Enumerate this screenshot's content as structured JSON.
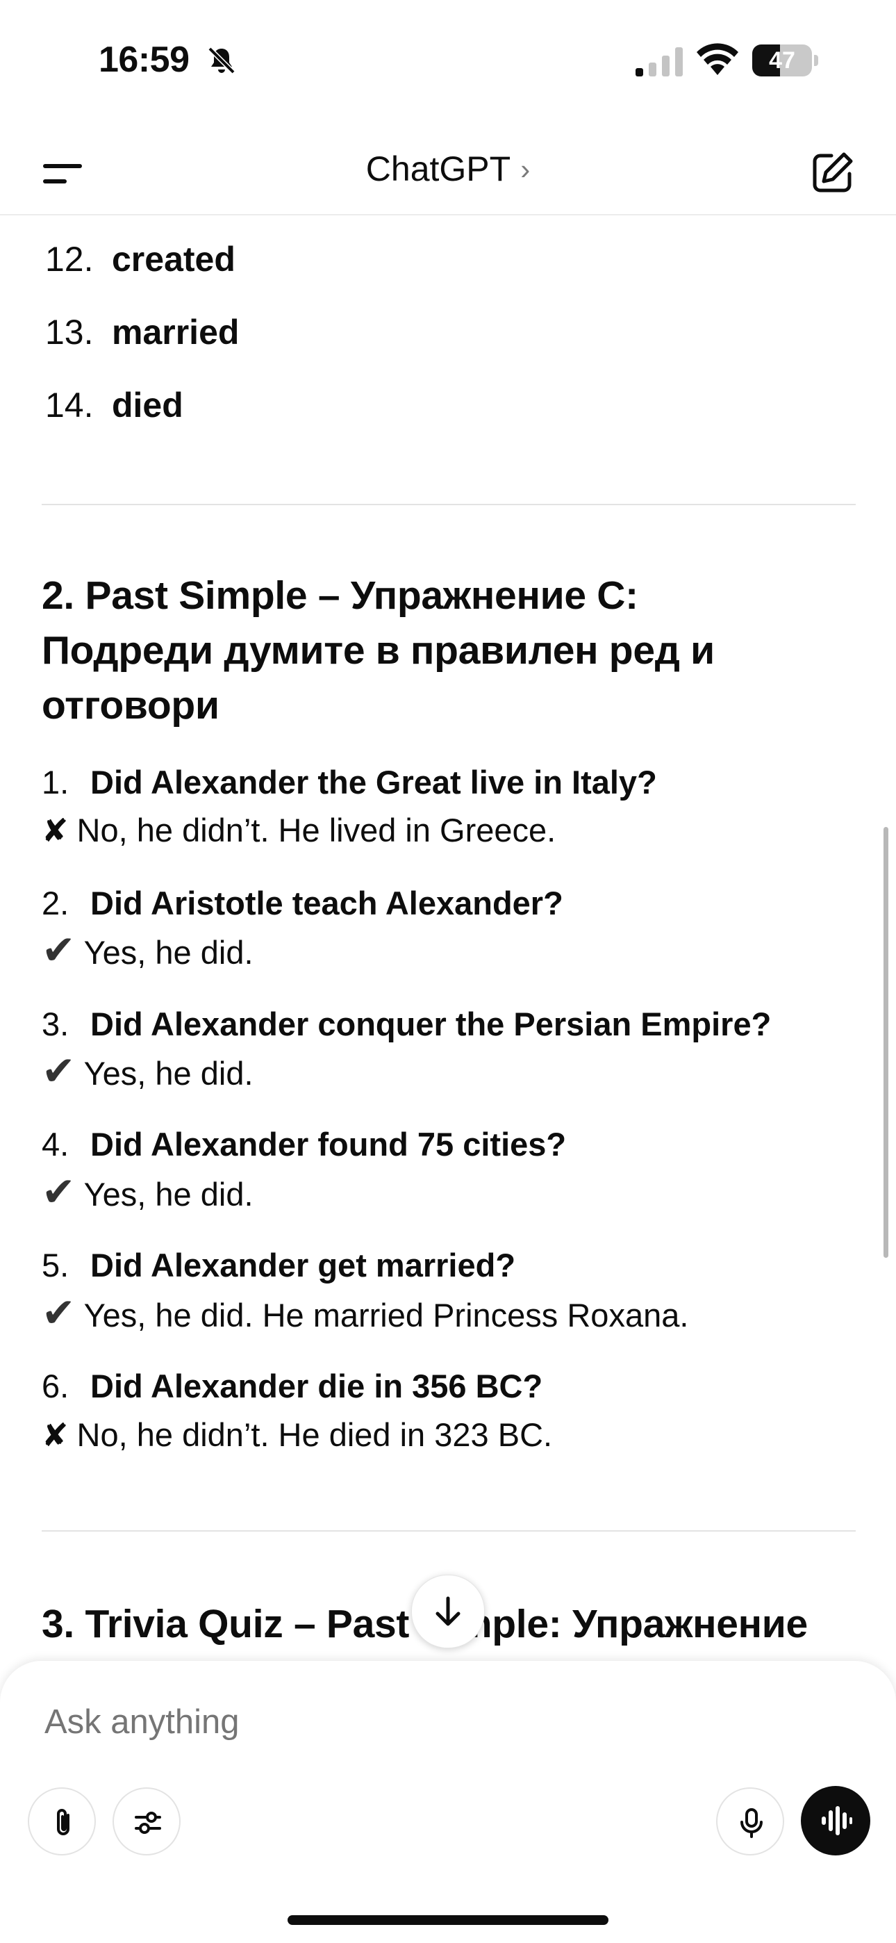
{
  "status_bar": {
    "time": "16:59",
    "battery_level": 47,
    "battery_label": "47"
  },
  "header": {
    "title": "ChatGPT",
    "chevron": "›"
  },
  "prev_list": [
    {
      "num": "12.",
      "word": "created"
    },
    {
      "num": "13.",
      "word": "married"
    },
    {
      "num": "14.",
      "word": "died"
    }
  ],
  "section2": {
    "heading_line1": "2. Past Simple – Упражнение C:",
    "heading_line2": "Подреди думите в правилен ред и",
    "heading_line3": "отговори",
    "items": [
      {
        "num": "1.",
        "question": "Did Alexander the Great live in Italy?",
        "mark": "✘",
        "answer": "No, he didn’t. He lived in Greece."
      },
      {
        "num": "2.",
        "question": "Did Aristotle teach Alexander?",
        "mark": "✔",
        "answer": "Yes, he did."
      },
      {
        "num": "3.",
        "question": "Did Alexander conquer the Persian Empire?",
        "mark": "✔",
        "answer": "Yes, he did."
      },
      {
        "num": "4.",
        "question": "Did Alexander found 75 cities?",
        "mark": "✔",
        "answer": "Yes, he did."
      },
      {
        "num": "5.",
        "question": "Did Alexander get married?",
        "mark": "✔",
        "answer": "Yes, he did. He married Princess Roxana."
      },
      {
        "num": "6.",
        "question": "Did Alexander die in 356 BC?",
        "mark": "✘",
        "answer": "No, he didn’t. He died in 323 BC."
      }
    ]
  },
  "section3": {
    "heading": "3. Trivia Quiz – Past Simple: Упражнение"
  },
  "composer": {
    "placeholder": "Ask anything"
  },
  "icons": {
    "menu": "menu-icon",
    "edit": "new-chat-icon",
    "attach": "paperclip-icon",
    "tools": "sliders-icon",
    "mic": "mic-icon",
    "voice": "voice-mode-icon",
    "scroll": "arrow-down-icon"
  }
}
